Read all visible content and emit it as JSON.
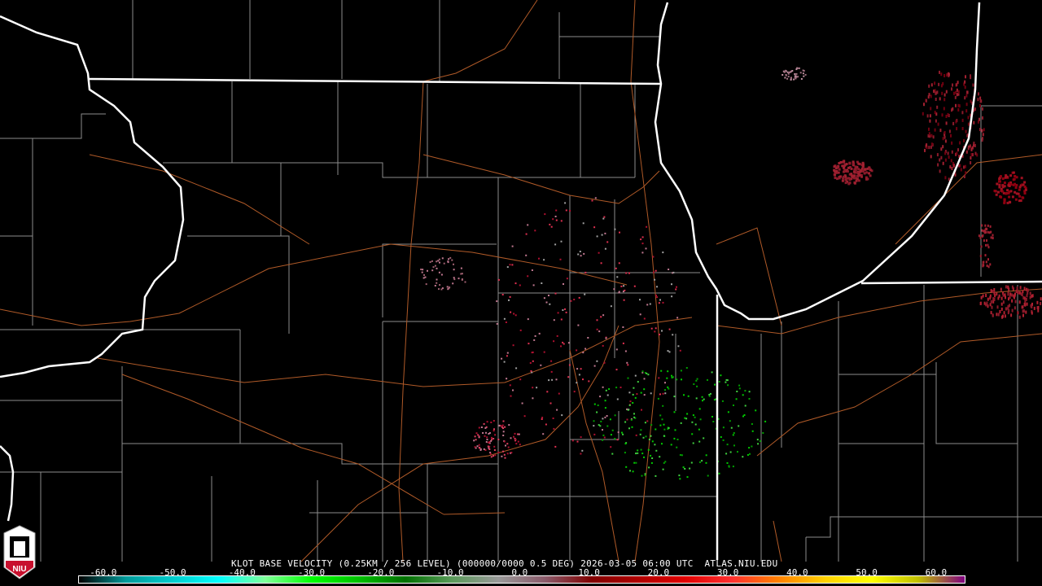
{
  "product_title": "KLOT BASE VELOCITY (0.25KM / 256 LEVEL) (000000/0000 0.5 DEG) 2026-03-05 06:00 UTC  ATLAS.NIU.EDU",
  "logo_text": "NIU",
  "colorbar": {
    "ticks": [
      "-60.0",
      "-50.0",
      "-40.0",
      "-30.0",
      "-20.0",
      "-10.0",
      "0.0",
      "10.0",
      "20.0",
      "30.0",
      "40.0",
      "50.0",
      "60.0"
    ],
    "tick_values": [
      -60,
      -50,
      -40,
      -30,
      -20,
      -10,
      0,
      10,
      20,
      30,
      40,
      50,
      60
    ],
    "range": [
      -63.5,
      64
    ],
    "stops": [
      "#000000",
      "#009a9a",
      "#00cccc",
      "#00ffff",
      "#80ff99",
      "#00ff00",
      "#00c000",
      "#007000",
      "#5a9a5a",
      "#999999",
      "#8a5a6a",
      "#800000",
      "#b00000",
      "#e00000",
      "#ff3030",
      "#ff8000",
      "#ffd000",
      "#ffff00",
      "#c0c000",
      "#800080"
    ]
  },
  "colors": {
    "state_border": "#ffffff",
    "county": "#8c8c8c",
    "road": "#b05a28",
    "inbound": "#00cc00",
    "outbound": "#b01030",
    "near_zero": "#c07890"
  }
}
